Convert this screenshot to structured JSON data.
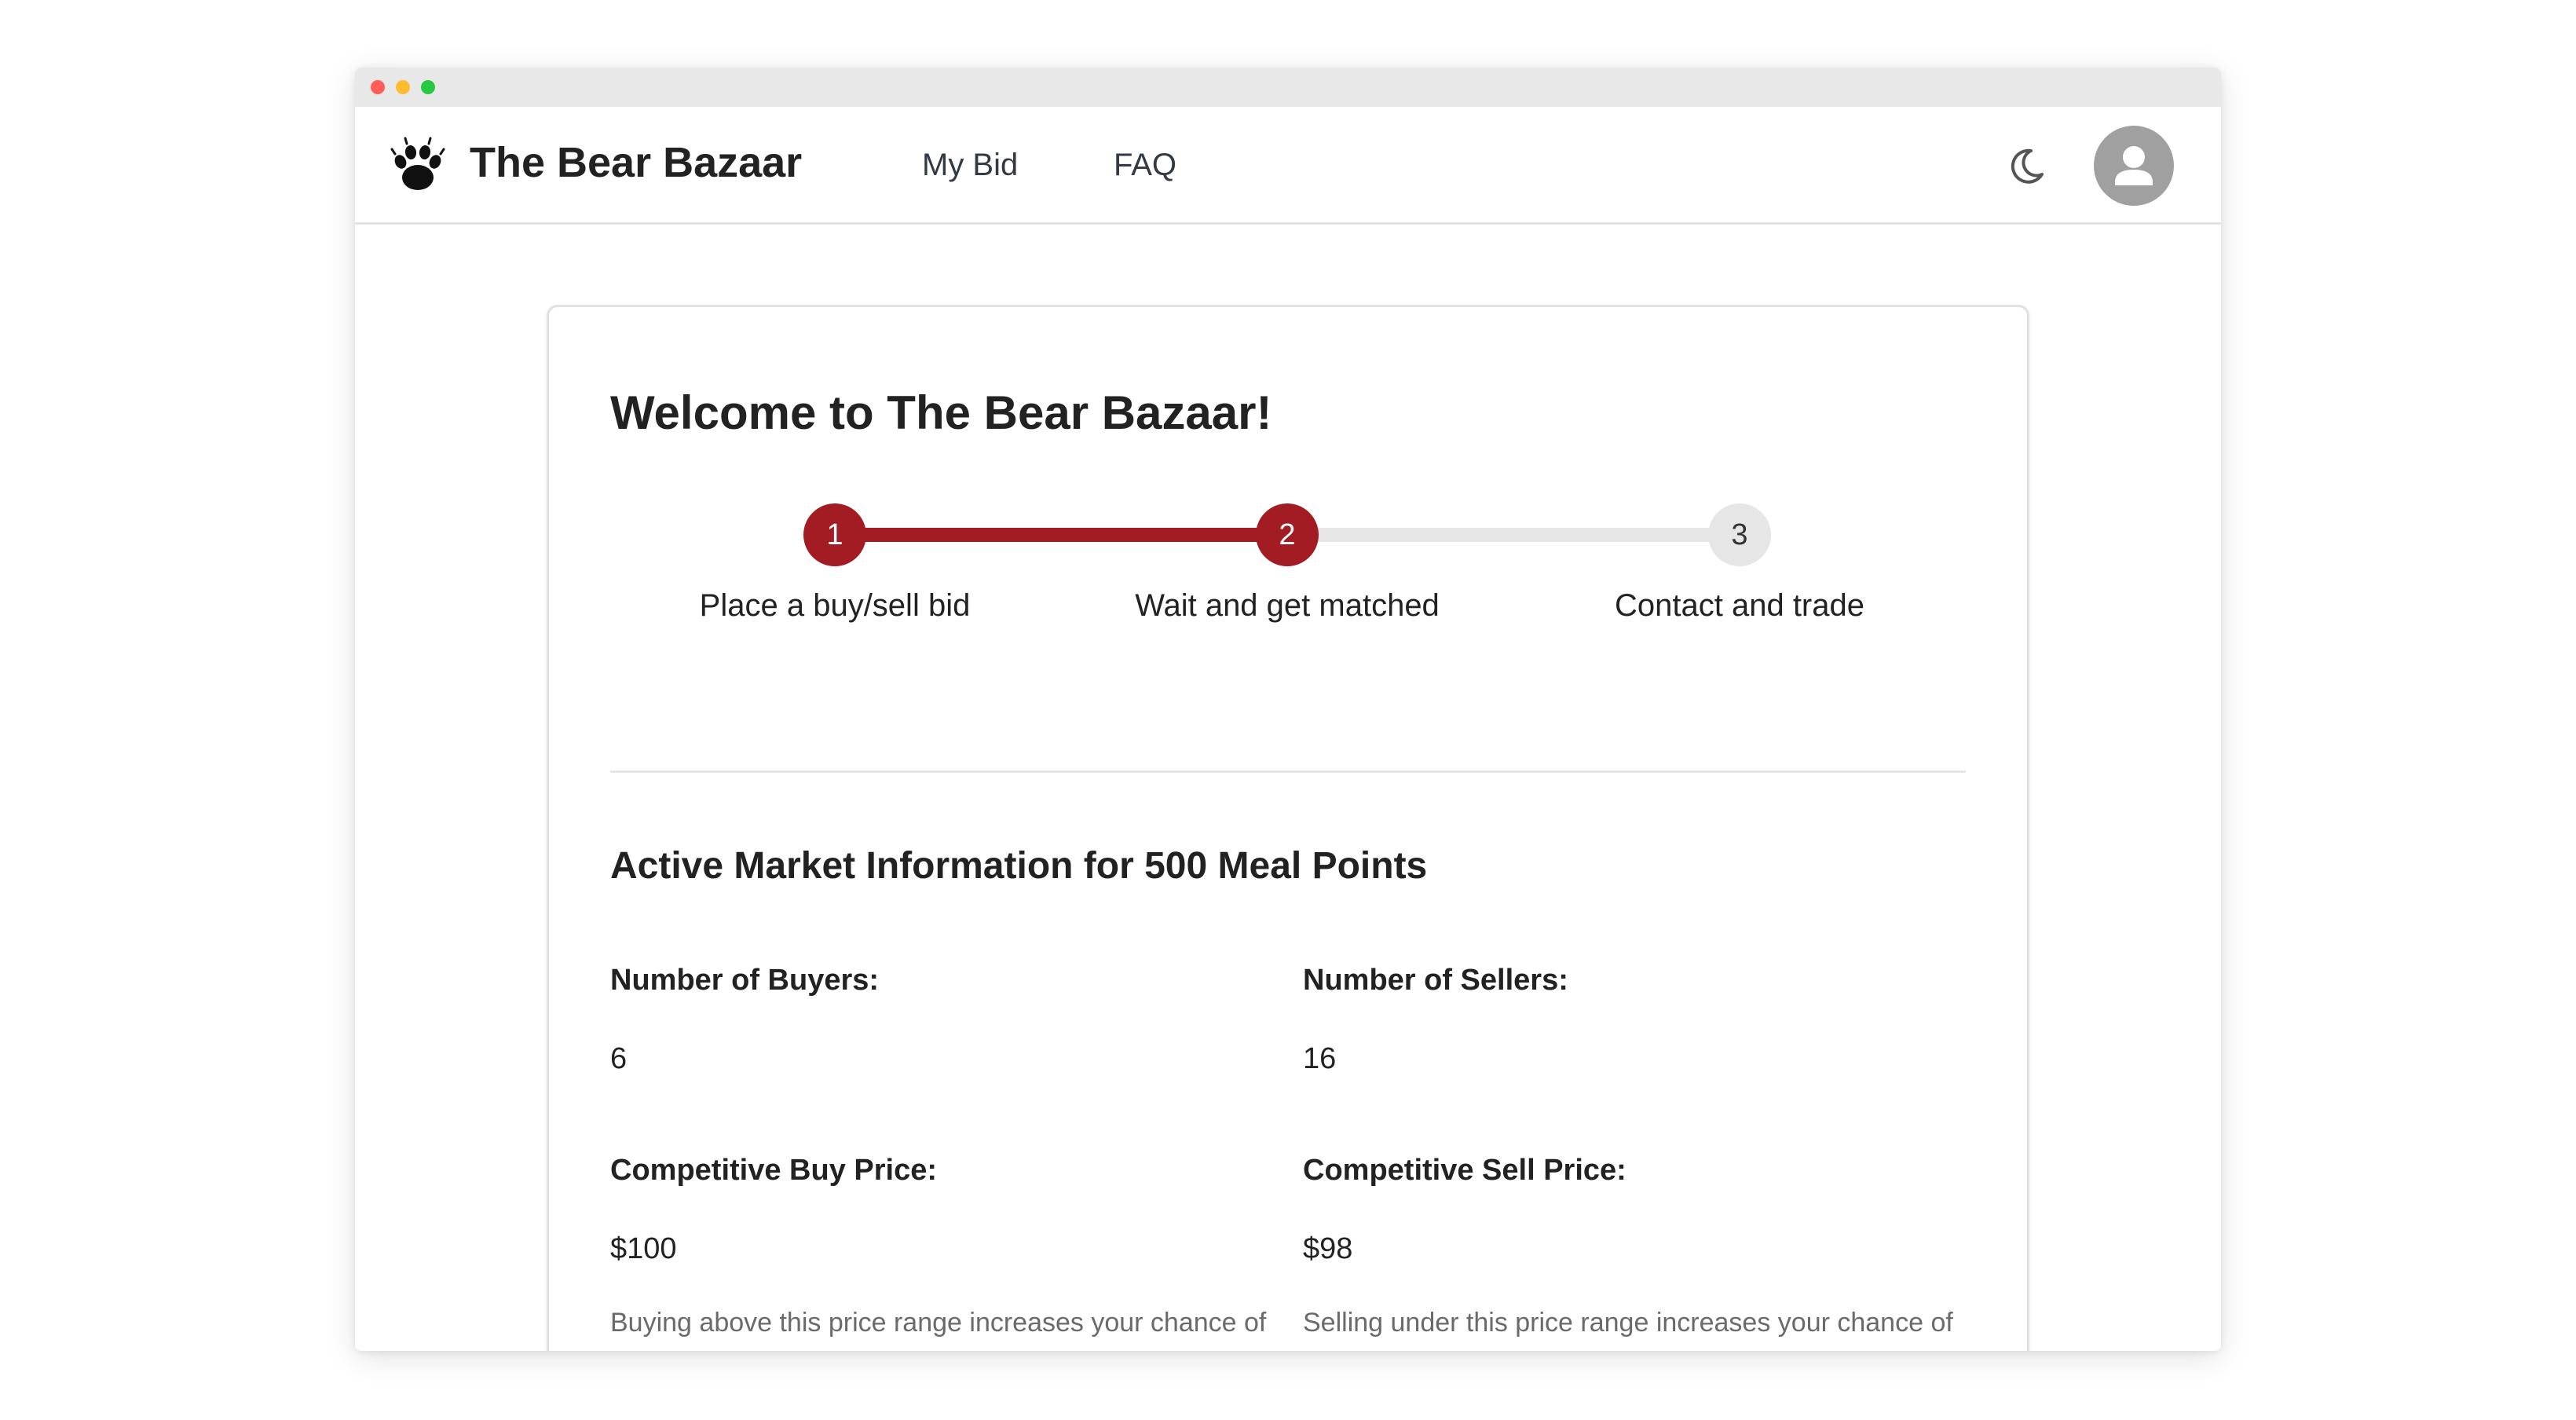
{
  "window": {
    "controls": [
      "close",
      "minimize",
      "zoom"
    ]
  },
  "navbar": {
    "logo_icon": "bear-paw-icon",
    "brand": "The Bear Bazaar",
    "links": [
      {
        "label": "My Bid"
      },
      {
        "label": "FAQ"
      }
    ],
    "theme_icon": "moon-icon",
    "avatar_icon": "user-avatar-icon"
  },
  "main": {
    "heading": "Welcome to The Bear Bazaar!",
    "steps": [
      {
        "number": "1",
        "label": "Place a buy/sell bid",
        "status": "complete"
      },
      {
        "number": "2",
        "label": "Wait and get matched",
        "status": "current"
      },
      {
        "number": "3",
        "label": "Contact and trade",
        "status": "upcoming"
      }
    ],
    "market": {
      "title": "Active Market Information for 500 Meal Points",
      "buyers": {
        "label": "Number of Buyers:",
        "value": "6"
      },
      "sellers": {
        "label": "Number of Sellers:",
        "value": "16"
      },
      "buy_price": {
        "label": "Competitive Buy Price:",
        "value": "$100",
        "hint": "Buying above this price range increases your chance of matching with a seller."
      },
      "sell_price": {
        "label": "Competitive Sell Price:",
        "value": "$98",
        "hint": "Selling under this price range increases your chance of matching with a buyer."
      }
    }
  },
  "colors": {
    "accent": "#a31c24",
    "inactive_step": "#e6e6e6",
    "text": "#222222",
    "muted_text": "#6a6a6a"
  }
}
